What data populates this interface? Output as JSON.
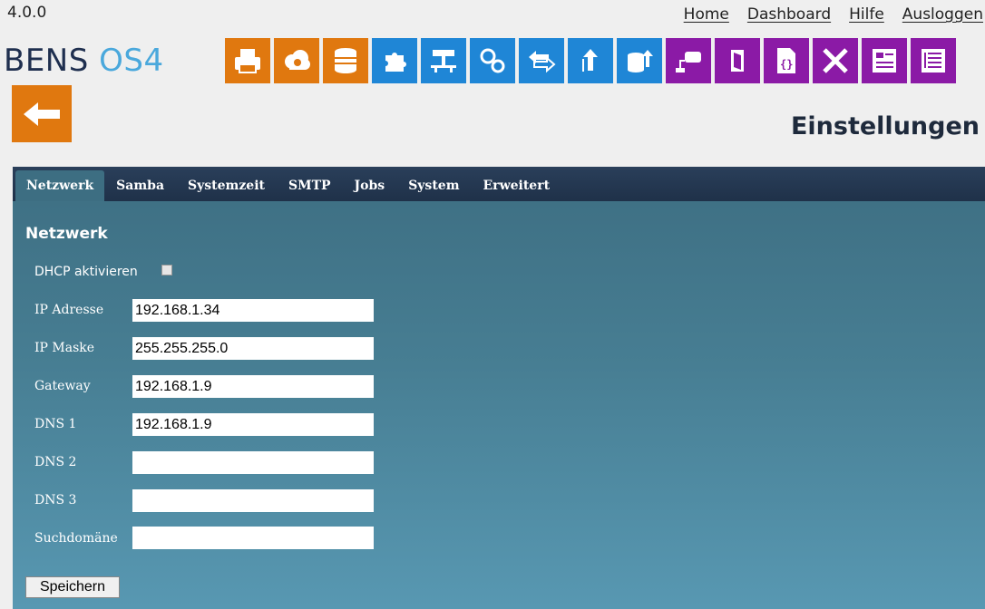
{
  "version": "4.0.0",
  "topnav": [
    "Home",
    "Dashboard",
    "Hilfe",
    "Ausloggen"
  ],
  "brand": {
    "part1": "BENS",
    "part2": "OS4"
  },
  "toolbar": [
    {
      "icon": "printer-icon",
      "color": "#e0780f"
    },
    {
      "icon": "cloud-icon",
      "color": "#e0780f"
    },
    {
      "icon": "database-icon",
      "color": "#e0780f"
    },
    {
      "icon": "puzzle-icon",
      "color": "#1f86d6"
    },
    {
      "icon": "network-icon",
      "color": "#1f86d6"
    },
    {
      "icon": "gears-icon",
      "color": "#1f86d6"
    },
    {
      "icon": "transfer-icon",
      "color": "#1f86d6"
    },
    {
      "icon": "upload-icon",
      "color": "#1f86d6"
    },
    {
      "icon": "db-upload-icon",
      "color": "#1f86d6"
    },
    {
      "icon": "scanner-icon",
      "color": "#8b1aa6"
    },
    {
      "icon": "door-icon",
      "color": "#8b1aa6"
    },
    {
      "icon": "code-file-icon",
      "color": "#8b1aa6"
    },
    {
      "icon": "tools-icon",
      "color": "#8b1aa6"
    },
    {
      "icon": "form-icon",
      "color": "#8b1aa6"
    },
    {
      "icon": "list-icon",
      "color": "#8b1aa6"
    }
  ],
  "page_title": "Einstellungen",
  "tabs": [
    "Netzwerk",
    "Samba",
    "Systemzeit",
    "SMTP",
    "Jobs",
    "System",
    "Erweitert"
  ],
  "active_tab": "Netzwerk",
  "section_title": "Netzwerk",
  "dhcp": {
    "label": "DHCP aktivieren",
    "checked": false
  },
  "fields": [
    {
      "label": "IP Adresse",
      "value": "192.168.1.34"
    },
    {
      "label": "IP Maske",
      "value": "255.255.255.0"
    },
    {
      "label": "Gateway",
      "value": "192.168.1.9"
    },
    {
      "label": "DNS 1",
      "value": "192.168.1.9"
    },
    {
      "label": "DNS 2",
      "value": ""
    },
    {
      "label": "DNS 3",
      "value": ""
    },
    {
      "label": "Suchdomäne",
      "value": ""
    }
  ],
  "save_label": "Speichern"
}
